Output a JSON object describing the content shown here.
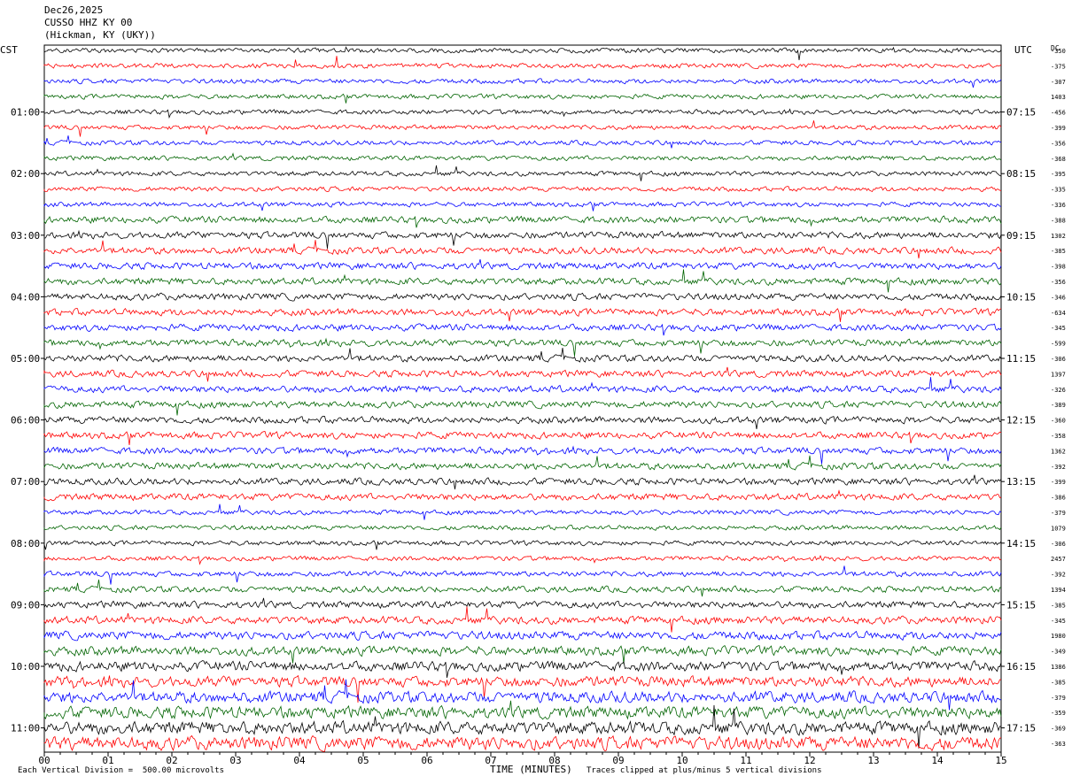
{
  "header": {
    "date": "Dec26,2025",
    "station": "CUSSO HHZ KY 00",
    "location": "(Hickman, KY (UKY))"
  },
  "chart_data": {
    "type": "line",
    "title": "CUSSO HHZ KY 00",
    "left_axis_label": "CST",
    "right_axis_label": "UTC",
    "dc_label": "DC",
    "left_time_labels": [
      "01:00",
      "02:00",
      "03:00",
      "04:00",
      "05:00",
      "06:00",
      "07:00",
      "08:00",
      "09:00",
      "10:00",
      "11:00"
    ],
    "right_time_labels": [
      "07:15",
      "08:15",
      "09:15",
      "10:15",
      "11:15",
      "12:15",
      "13:15",
      "14:15",
      "15:15",
      "16:15",
      "17:15"
    ],
    "x_ticks": [
      "00",
      "01",
      "02",
      "03",
      "04",
      "05",
      "06",
      "07",
      "08",
      "09",
      "10",
      "11",
      "12",
      "13",
      "14",
      "15"
    ],
    "xlabel": "TIME (MINUTES)",
    "xlim": [
      0,
      15
    ],
    "trace_minutes_each": 15,
    "traces_per_hour": 4,
    "trace_colors": [
      "#000000",
      "#ff0000",
      "#0000ff",
      "#006400"
    ],
    "dc_offsets": [
      "-350",
      "-375",
      "-307",
      "1403",
      "-456",
      "-399",
      "-356",
      "-368",
      "-395",
      "-335",
      "-336",
      "-388",
      "1302",
      "-385",
      "-398",
      "-356",
      "-346",
      "-634",
      "-345",
      "-599",
      "-306",
      "1397",
      "-326",
      "-389",
      "-360",
      "-358",
      "1362",
      "-392",
      "-399",
      "-386",
      "-379",
      "1079",
      "-306",
      "2457",
      "-392",
      "1394",
      "-385",
      "-345",
      "1980",
      "-349",
      "1386",
      "-385",
      "-379",
      "-359",
      "-369",
      "-363"
    ],
    "footer_left": "Each Vertical Division =  500.00 microvolts",
    "footer_right": "Traces clipped at plus/minus 5 vertical divisions"
  }
}
